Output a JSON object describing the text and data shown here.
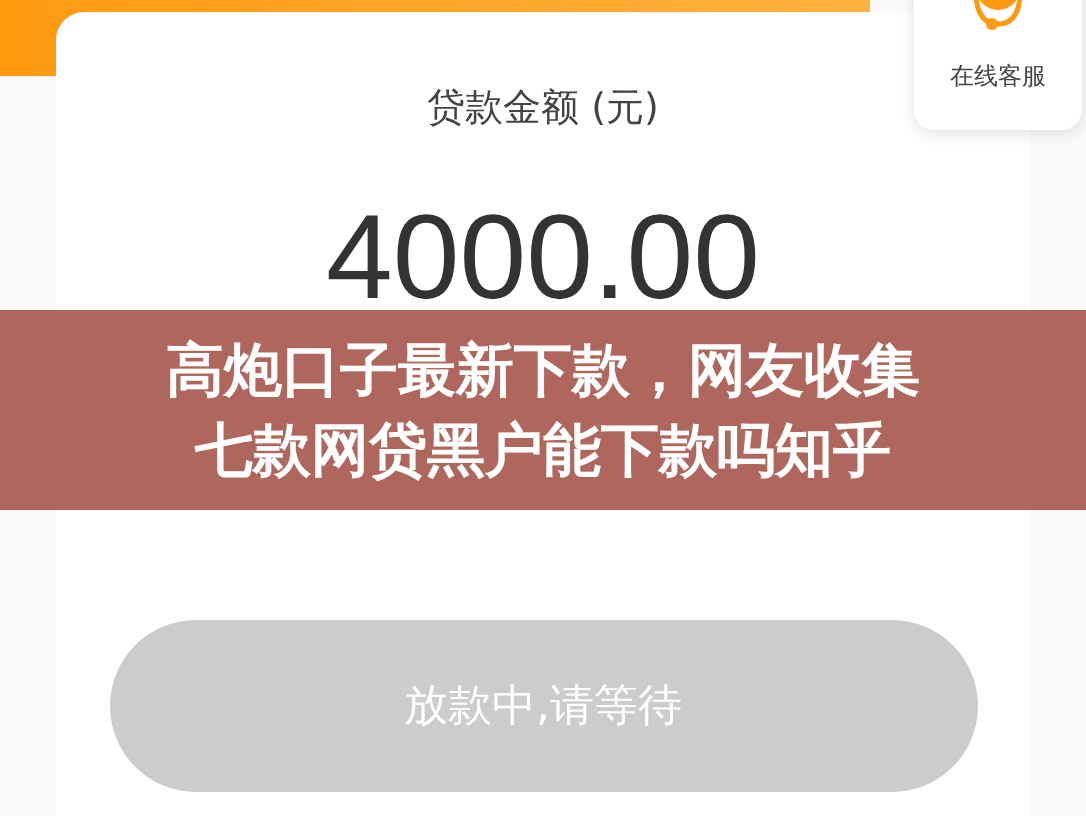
{
  "loan_card": {
    "label": "贷款金额 (元)",
    "amount": "4000.00"
  },
  "action_button": {
    "label": "放款中,请等待",
    "disabled": true
  },
  "service_widget": {
    "label": "在线客服"
  },
  "banner": {
    "lines": [
      "高炮口子最新下款，网友收集",
      "七款网贷黑户能下款吗知乎"
    ]
  }
}
